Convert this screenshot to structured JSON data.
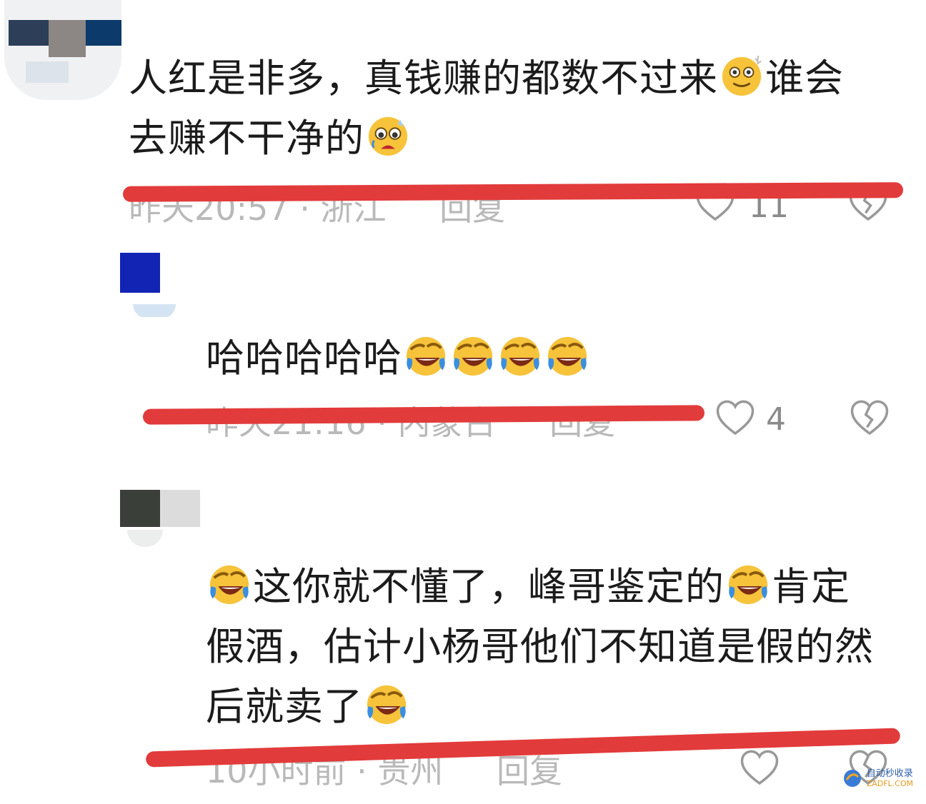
{
  "comments": [
    {
      "text_line1": "人红是非多，真钱赚的都数不过来",
      "text_line1_b": "谁会",
      "text_line2": "去赚不干净的",
      "time": "昨天20:57",
      "location": "浙江",
      "reply": "回复",
      "likes": "11"
    },
    {
      "text": "哈哈哈哈哈",
      "time": "昨天21:16",
      "location": "内蒙古",
      "reply": "回复",
      "likes": "4"
    },
    {
      "text_a": "这你就不懂了，峰哥鉴定的",
      "text_b": "肯定",
      "text_line2": "假酒，估计小杨哥他们不知道是假的然",
      "text_line3": "后就卖了",
      "time": "10小时前",
      "location": "贵州",
      "reply": "回复",
      "likes": ""
    }
  ],
  "meta_separator": "·",
  "watermark": {
    "line1": "自动秒收录",
    "line2": "ZADFL.COM"
  },
  "icons": [
    "smile-emoji",
    "teary-emoji",
    "laughing-crying-emoji",
    "heart-icon",
    "broken-heart-icon"
  ],
  "colors": {
    "strike": "#e23b3b",
    "text": "#1b1b1b",
    "meta": "#b9b9b9"
  }
}
